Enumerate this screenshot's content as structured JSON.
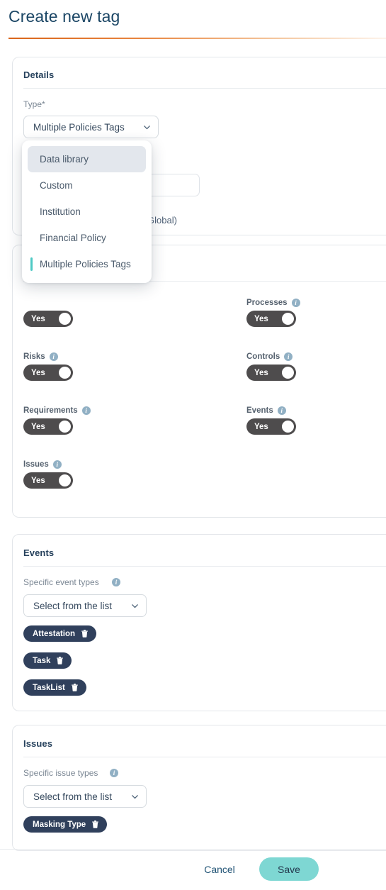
{
  "header": {
    "title": "Create new tag"
  },
  "details": {
    "section_title": "Details",
    "type_label": "Type*",
    "type_value": "Multiple Policies Tags",
    "name_value": "",
    "scope_text": "Global)",
    "dropdown": {
      "options": [
        {
          "label": "Data library",
          "hovered": true,
          "selected": false
        },
        {
          "label": "Custom",
          "hovered": false,
          "selected": false
        },
        {
          "label": "Institution",
          "hovered": false,
          "selected": false
        },
        {
          "label": "Financial Policy",
          "hovered": false,
          "selected": false
        },
        {
          "label": "Multiple Policies Tags",
          "hovered": false,
          "selected": true
        }
      ]
    }
  },
  "toggles": {
    "rows": [
      {
        "label": "",
        "value": "Yes",
        "info": true,
        "col": "left",
        "row": 0
      },
      {
        "label": "Processes",
        "value": "Yes",
        "info": true,
        "col": "right",
        "row": 0
      },
      {
        "label": "Risks",
        "value": "Yes",
        "info": true,
        "col": "left",
        "row": 1
      },
      {
        "label": "Controls",
        "value": "Yes",
        "info": true,
        "col": "right",
        "row": 1
      },
      {
        "label": "Requirements",
        "value": "Yes",
        "info": true,
        "col": "left",
        "row": 2
      },
      {
        "label": "Events",
        "value": "Yes",
        "info": true,
        "col": "right",
        "row": 2
      },
      {
        "label": "Issues",
        "value": "Yes",
        "info": true,
        "col": "left",
        "row": 3
      }
    ]
  },
  "events": {
    "section_title": "Events",
    "field_label": "Specific event types",
    "select_placeholder": "Select from the list",
    "chips": [
      "Attestation",
      "Task",
      "TaskList"
    ]
  },
  "issues": {
    "section_title": "Issues",
    "field_label": "Specific issue types",
    "select_placeholder": "Select from the list",
    "chips": [
      "Masking Type"
    ]
  },
  "footer": {
    "cancel_label": "Cancel",
    "save_label": "Save"
  },
  "colors": {
    "title": "#1b4665",
    "accent_orange": "#d9651a",
    "accent_teal": "#4ec9c4",
    "save_bg": "#7ed7d3",
    "chip_bg": "#30405c",
    "toggle_bg": "#4e4c4d",
    "info_icon": "#91b0c4"
  }
}
